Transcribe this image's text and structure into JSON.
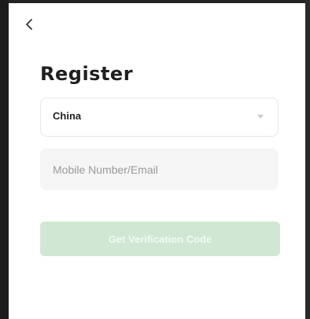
{
  "header": {
    "back_icon": "chevron-left-icon"
  },
  "page": {
    "title": "Register"
  },
  "form": {
    "country": {
      "selected": "China",
      "icon": "chevron-down-icon"
    },
    "account_field": {
      "value": "",
      "placeholder": "Mobile Number/Email"
    },
    "submit_label": "Get Verification Code"
  },
  "colors": {
    "accent_disabled": "#cfe7d3",
    "input_background": "#f5f5f5"
  }
}
